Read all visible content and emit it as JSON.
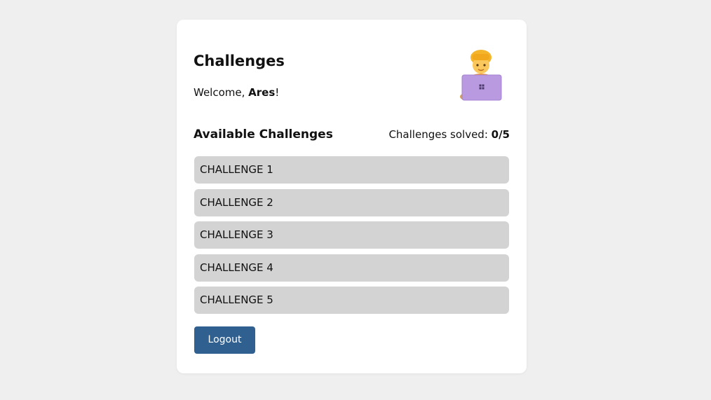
{
  "header": {
    "title": "Challenges",
    "welcome_prefix": "Welcome, ",
    "username": "Ares",
    "welcome_suffix": "!",
    "avatar_icon": "person-at-laptop-icon"
  },
  "challenges": {
    "heading": "Available Challenges",
    "solved_label": "Challenges solved: ",
    "solved_value": "0/5",
    "items": [
      {
        "label": "CHALLENGE 1"
      },
      {
        "label": "CHALLENGE 2"
      },
      {
        "label": "CHALLENGE 3"
      },
      {
        "label": "CHALLENGE 4"
      },
      {
        "label": "CHALLENGE 5"
      }
    ]
  },
  "actions": {
    "logout_label": "Logout"
  },
  "colors": {
    "page_background": "#efefef",
    "card_background": "#ffffff",
    "item_background": "#d3d3d3",
    "logout_button": "#2f6090"
  }
}
